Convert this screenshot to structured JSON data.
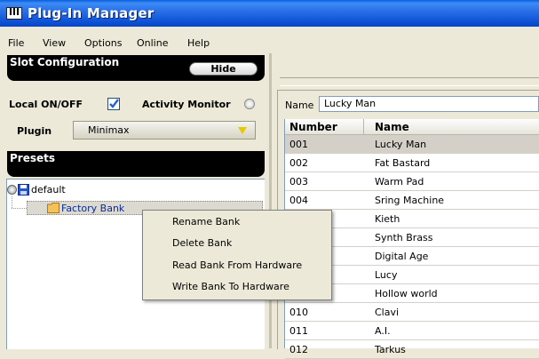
{
  "window": {
    "title": "Plug-In Manager"
  },
  "menubar": {
    "items": [
      "File",
      "View",
      "Options",
      "Online",
      "Help"
    ]
  },
  "slot": {
    "header": "Slot Configuration",
    "hide_label": "Hide",
    "local_label": "Local ON/OFF",
    "local_checked": true,
    "activity_label": "Activity Monitor",
    "plugin_label": "Plugin",
    "plugin_value": "Minimax"
  },
  "presets": {
    "header": "Presets",
    "tree": [
      {
        "label": "default"
      },
      {
        "label": "Factory Bank",
        "selected": true
      }
    ]
  },
  "context_menu": {
    "items": [
      "Rename Bank",
      "Delete Bank",
      "Read Bank From Hardware",
      "Write Bank To Hardware"
    ]
  },
  "bank": {
    "name_label": "Name",
    "name_value": "Lucky Man",
    "columns": [
      "Number",
      "Name"
    ],
    "rows": [
      {
        "number": "001",
        "name": "Lucky Man"
      },
      {
        "number": "002",
        "name": "Fat Bastard"
      },
      {
        "number": "003",
        "name": "Warm Pad"
      },
      {
        "number": "004",
        "name": "Sring Machine"
      },
      {
        "number": "",
        "name": "Kieth"
      },
      {
        "number": "",
        "name": "Synth Brass"
      },
      {
        "number": "",
        "name": "Digital Age"
      },
      {
        "number": "",
        "name": "Lucy"
      },
      {
        "number": "",
        "name": "Hollow world"
      },
      {
        "number": "010",
        "name": "Clavi"
      },
      {
        "number": "011",
        "name": "A.I."
      },
      {
        "number": "012",
        "name": "Tarkus"
      }
    ]
  },
  "colors": {
    "title_bar": "#0a5ee0",
    "header_black": "#000000",
    "checkbox_blue": "#2f5fd0",
    "dropdown_arrow": "#e8c800"
  }
}
